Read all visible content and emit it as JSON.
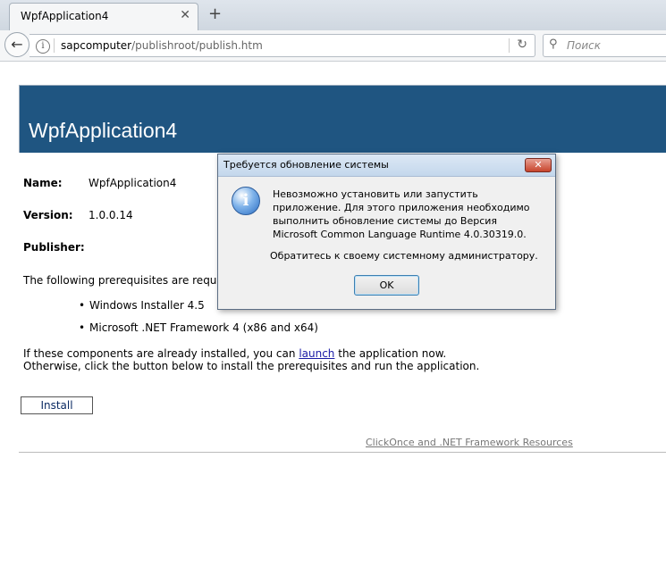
{
  "browser": {
    "tab_title": "WpfApplication4",
    "tab_close": "✕",
    "new_tab": "+",
    "url_host": "sapcomputer",
    "url_path": "/publishroot/publish.htm",
    "search_placeholder": "Поиск"
  },
  "page": {
    "app_title": "WpfApplication4",
    "name_label": "Name:",
    "name_value": "WpfApplication4",
    "version_label": "Version:",
    "version_value": "1.0.0.14",
    "publisher_label": "Publisher:",
    "prereq_intro": "The following prerequisites are required",
    "prerequisites": [
      "Windows Installer 4.5",
      "Microsoft .NET Framework 4 (x86 and x64)"
    ],
    "para_before": "If these components are already installed, you can ",
    "launch_link": "launch",
    "para_after": " the application now. Otherwise, click the button below to install the prerequisites and run the application.",
    "install_button": "Install",
    "resources_link": "ClickOnce and .NET Framework Resources"
  },
  "dialog": {
    "title": "Требуется обновление системы",
    "message": "Невозможно установить или запустить приложение. Для этого приложения необходимо выполнить обновление системы до Версия Microsoft Common Language Runtime 4.0.30319.0.",
    "admin_note": "Обратитесь к своему системному администратору.",
    "ok_button": "OK"
  }
}
